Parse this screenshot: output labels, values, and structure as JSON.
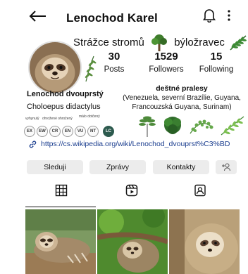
{
  "header": {
    "username": "Lenochod Karel",
    "icons": {
      "back": "arrow-left-icon",
      "notifications": "bell-icon",
      "more": "more-vertical-icon"
    }
  },
  "bio": {
    "part1": "Strážce stromů",
    "part2": "býložravec",
    "species_name": "Lenochod dvouprstý",
    "species_latin": "Choloepus didactylus",
    "habitat_title": "deštné pralesy",
    "habitat_line1": "(Venezuela, severní Brazílie, Guyana,",
    "habitat_line2": "Francouzská Guyana, Surinam)",
    "link": "https://cs.wikipedia.org/wiki/Lenochod_dvouprst%C3%BD"
  },
  "stats": {
    "posts": {
      "value": "30",
      "label": "Posts"
    },
    "followers": {
      "value": "1529",
      "label": "Followers"
    },
    "following": {
      "value": "15",
      "label": "Following"
    }
  },
  "iucn": {
    "labels": [
      "vyhynulý",
      "ohrožené ohrožený",
      "málo dotčený"
    ],
    "codes": [
      "EX",
      "EW",
      "CR",
      "EN",
      "VU",
      "NT",
      "LC"
    ],
    "active": "LC",
    "active_color": "#2d5a4e"
  },
  "actions": {
    "follow": "Sleduji",
    "message": "Zprávy",
    "contacts": "Kontakty"
  },
  "tabs": [
    "grid-icon",
    "reels-icon",
    "tagged-icon"
  ],
  "photos": [
    "sloth-photo-1",
    "sloth-photo-2",
    "sloth-photo-3"
  ],
  "colors": {
    "link": "#1b3e8f",
    "button_bg": "#ececec"
  }
}
